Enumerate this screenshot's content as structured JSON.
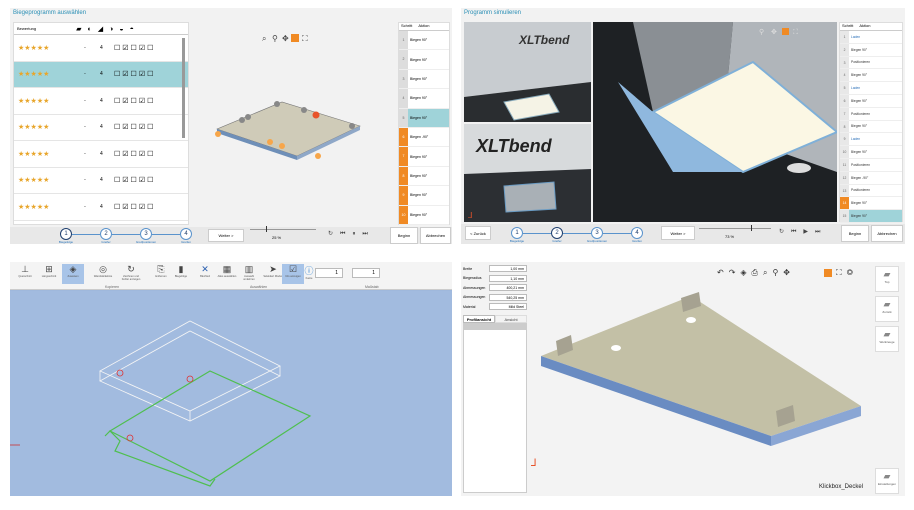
{
  "q1": {
    "title": "Biegeprogramm auswählen",
    "col_label": "Bewertung",
    "rows": [
      {
        "stars": "★★★★★",
        "dash": "-",
        "count": "4"
      },
      {
        "stars": "★★★★★",
        "dash": "-",
        "count": "4"
      },
      {
        "stars": "★★★★★",
        "dash": "-",
        "count": "4"
      },
      {
        "stars": "★★★★★",
        "dash": "-",
        "count": "4"
      },
      {
        "stars": "★★★★★",
        "dash": "-",
        "count": "4"
      },
      {
        "stars": "★★★★★",
        "dash": "-",
        "count": "4"
      },
      {
        "stars": "★★★★★",
        "dash": "-",
        "count": "4"
      }
    ],
    "side_header": [
      "Schritt",
      "Aktion"
    ],
    "side_rows": [
      "Biegen 90°",
      "Biegen 90°",
      "Biegen 90°",
      "Biegen 90°",
      "Biegen 90°",
      "Biegen -90°",
      "Biegen 90°",
      "Biegen 90°",
      "Biegen 90°",
      "Biegen 90°"
    ],
    "steps": [
      "Biegefolge",
      "Greifer",
      "Greifpositionen",
      "Greifen"
    ],
    "weiter": "Weiter >",
    "progress_value": 0.25,
    "progress_text": "25 %",
    "beginn": "Beginn",
    "abbrechen": "Abbrechen"
  },
  "q2": {
    "title": "Programm simulieren",
    "brand": "XLTbend",
    "side_header": [
      "Schritt",
      "Aktion"
    ],
    "side_rows": [
      "Laden",
      "Biegen 90°",
      "Positionieren",
      "Biegen 90°",
      "Laden",
      "Biegen 90°",
      "Positionieren",
      "Biegen 90°",
      "Laden",
      "Biegen 90°",
      "Positionieren",
      "Biegen -90°",
      "Positionieren",
      "Biegen 90°",
      "Biegen 90°"
    ],
    "steps": [
      "Biegefolge",
      "Greifer",
      "Greifpositionen",
      "Greifen"
    ],
    "zurueck": "< Zurück",
    "weiter": "Weiter >",
    "progress_value": 0.73,
    "progress_text": "73 %",
    "beginn": "Beginn",
    "abbrechen": "Abbrechen"
  },
  "q3": {
    "tools": [
      "Querschnitt",
      "Längsschnitt",
      "Zuweisen",
      "Wandstärkelinie",
      "Zeichnen und Fehler anzeigen",
      "Entfernen",
      "Biegefolge",
      "Blechteil",
      "Alles auswählen",
      "Auswahl umkehren",
      "Selektiert Modus",
      "Info anzeigen",
      "Kante"
    ],
    "groups": [
      "Kopieren",
      "Auswählen",
      "Maßstab"
    ],
    "num1": "1",
    "num2": "1"
  },
  "q4": {
    "fields": [
      {
        "label": "Breite",
        "value": "1,00 mm"
      },
      {
        "label": "Biegeradius",
        "value": "1,10 mm"
      },
      {
        "label": "Abmessungen",
        "value": "400,21 mm"
      },
      {
        "label": "Abmessungen",
        "value": "540,25 mm"
      },
      {
        "label": "Material",
        "value": "Mild Steel"
      }
    ],
    "tabs": [
      "Profilansicht",
      "Ansicht"
    ],
    "right_buttons": [
      "Top",
      "Zurück",
      "Werkzeuge",
      "Einstellungen"
    ],
    "part_name": "Klickbox_Deckel"
  }
}
